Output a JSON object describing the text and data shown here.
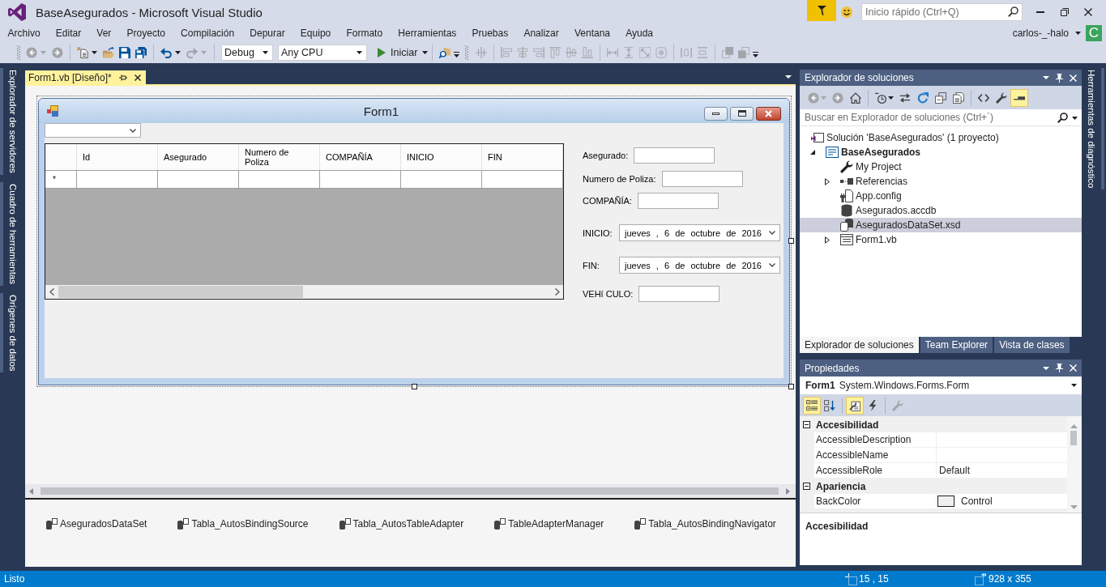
{
  "window": {
    "title": "BaseAsegurados - Microsoft Visual Studio"
  },
  "title_bar": {
    "quick_launch": {
      "placeholder": "Inicio rápido (Ctrl+Q)"
    }
  },
  "menu": [
    "Archivo",
    "Editar",
    "Ver",
    "Proyecto",
    "Compilación",
    "Depurar",
    "Equipo",
    "Formato",
    "Herramientas",
    "Pruebas",
    "Analizar",
    "Ventana",
    "Ayuda"
  ],
  "account": {
    "user": "carlos-_-halo",
    "avatar": "C"
  },
  "toolbar": {
    "items": [
      {
        "kind": "grip"
      },
      {
        "kind": "back",
        "disabled": true
      },
      {
        "kind": "forward",
        "disabled": true
      },
      {
        "kind": "separator"
      },
      {
        "kind": "new-project",
        "disabled": false
      },
      {
        "kind": "open",
        "disabled": false
      },
      {
        "kind": "save",
        "disabled": false
      },
      {
        "kind": "save-all",
        "disabled": false
      },
      {
        "kind": "separator"
      },
      {
        "kind": "undo",
        "disabled": false
      },
      {
        "kind": "redo",
        "disabled": true
      },
      {
        "kind": "separator"
      },
      {
        "kind": "combo",
        "value": "Debug"
      },
      {
        "kind": "combo",
        "value": "Any CPU"
      },
      {
        "kind": "start",
        "label": "Iniciar"
      },
      {
        "kind": "separator"
      },
      {
        "kind": "find-in-files",
        "disabled": false
      },
      {
        "kind": "overflow"
      },
      {
        "kind": "grip"
      },
      {
        "kind": "align-to-grid",
        "disabled": true
      },
      {
        "kind": "separator"
      },
      {
        "kind": "align-lefts",
        "disabled": true
      },
      {
        "kind": "align-centers",
        "disabled": true
      },
      {
        "kind": "align-rights",
        "disabled": true
      },
      {
        "kind": "align-tops",
        "disabled": true
      },
      {
        "kind": "align-middles",
        "disabled": true
      },
      {
        "kind": "align-bottoms",
        "disabled": true
      },
      {
        "kind": "separator"
      },
      {
        "kind": "same-width",
        "disabled": true
      },
      {
        "kind": "same-height",
        "disabled": true
      },
      {
        "kind": "same-size",
        "disabled": true
      },
      {
        "kind": "size-to-grid",
        "disabled": true
      },
      {
        "kind": "separator"
      },
      {
        "kind": "horizontal-spacing",
        "disabled": true
      },
      {
        "kind": "vertical-spacing",
        "disabled": true
      },
      {
        "kind": "separator"
      },
      {
        "kind": "bring-to-front",
        "disabled": true
      },
      {
        "kind": "send-to-back",
        "disabled": true
      },
      {
        "kind": "overflow"
      }
    ]
  },
  "side_tabs": {
    "left": [
      "Explorador de servidores",
      "Cuadro de herramientas",
      "Orígenes de datos"
    ],
    "right": [
      "Herramientas de diagnóstico"
    ]
  },
  "document": {
    "tabs": [
      {
        "label": "Form1.vb [Diseño]*",
        "selected": true
      }
    ],
    "form": {
      "title": "Form1",
      "grid": {
        "columns": [
          "Id",
          "Asegurado",
          "Numero de Poliza",
          "COMPAÑÍA",
          "INICIO",
          "FIN"
        ],
        "new_row_marker": "*"
      },
      "fields": [
        {
          "kind": "text",
          "label": "Asegurado:"
        },
        {
          "kind": "text",
          "label": "Numero de Poliza:"
        },
        {
          "kind": "text",
          "label": "COMPAÑÍA:"
        },
        {
          "kind": "date",
          "label": "INICIO:",
          "value": "jueves , 6 de octubre de 2016"
        },
        {
          "kind": "date",
          "label": "FIN:",
          "value": "jueves , 6 de octubre de 2016"
        },
        {
          "kind": "text",
          "label": "VEHí CULO:"
        }
      ]
    },
    "component_tray": [
      "AseguradosDataSet",
      "Tabla_AutosBindingSource",
      "Tabla_AutosTableAdapter",
      "TableAdapterManager",
      "Tabla_AutosBindingNavigator"
    ]
  },
  "solution_explorer": {
    "title": "Explorador de soluciones",
    "toolbar": [
      {
        "kind": "back",
        "disabled": true,
        "on": false
      },
      {
        "kind": "forward",
        "disabled": true,
        "on": false
      },
      {
        "kind": "home",
        "disabled": false,
        "on": false
      },
      {
        "kind": "separator"
      },
      {
        "kind": "pending-changes",
        "disabled": false,
        "on": false
      },
      {
        "kind": "sync",
        "disabled": false,
        "on": false
      },
      {
        "kind": "refresh",
        "disabled": false,
        "on": false
      },
      {
        "kind": "collapse-all",
        "disabled": false,
        "on": false
      },
      {
        "kind": "show-all-files",
        "disabled": false,
        "on": false
      },
      {
        "kind": "separator"
      },
      {
        "kind": "view-code",
        "disabled": false,
        "on": false
      },
      {
        "kind": "properties",
        "disabled": false,
        "on": false
      },
      {
        "kind": "preview",
        "disabled": false,
        "on": true
      }
    ],
    "search": {
      "placeholder": "Buscar en Explorador de soluciones (Ctrl+´)"
    },
    "tree": [
      {
        "kind": "solution",
        "label": "Solución 'BaseAsegurados' (1 proyecto)",
        "selected": false,
        "children": [
          {
            "kind": "project",
            "label": "BaseAsegurados",
            "selected": false,
            "expanded": true,
            "children": [
              {
                "kind": "my-project",
                "label": "My Project",
                "selected": false
              },
              {
                "kind": "references",
                "label": "Referencias",
                "selected": false,
                "expanded": false
              },
              {
                "kind": "config",
                "label": "App.config",
                "selected": false
              },
              {
                "kind": "database",
                "label": "Asegurados.accdb",
                "selected": false
              },
              {
                "kind": "dataset",
                "label": "AseguradosDataSet.xsd",
                "selected": true
              },
              {
                "kind": "form",
                "label": "Form1.vb",
                "selected": false,
                "expanded": false
              }
            ]
          }
        ]
      }
    ],
    "tabs": [
      {
        "label": "Explorador de soluciones",
        "selected": true
      },
      {
        "label": "Team Explorer",
        "selected": false
      },
      {
        "label": "Vista de clases",
        "selected": false
      }
    ]
  },
  "properties": {
    "title": "Propiedades",
    "object": {
      "name": "Form1",
      "type": "System.Windows.Forms.Form"
    },
    "toolbar": [
      {
        "kind": "categorized",
        "disabled": false,
        "on": true
      },
      {
        "kind": "alphabetical",
        "disabled": false,
        "on": false
      },
      {
        "kind": "separator"
      },
      {
        "kind": "property-page",
        "disabled": false,
        "on": true
      },
      {
        "kind": "events",
        "disabled": false,
        "on": false
      },
      {
        "kind": "separator"
      },
      {
        "kind": "property-pages",
        "disabled": true,
        "on": false
      }
    ],
    "categories": [
      {
        "name": "Accesibilidad",
        "expanded": true,
        "properties": [
          {
            "name": "AccessibleDescription"
          },
          {
            "name": "AccessibleName"
          },
          {
            "name": "AccessibleRole",
            "value": "Default"
          }
        ]
      },
      {
        "name": "Apariencia",
        "expanded": true,
        "properties": [
          {
            "name": "BackColor",
            "value": "Control",
            "color": "#f0f0f0"
          }
        ]
      }
    ],
    "description": {
      "title": "Accesibilidad"
    }
  },
  "status_bar": {
    "text": "Listo",
    "position": "15 , 15",
    "size": "928 x 355"
  }
}
